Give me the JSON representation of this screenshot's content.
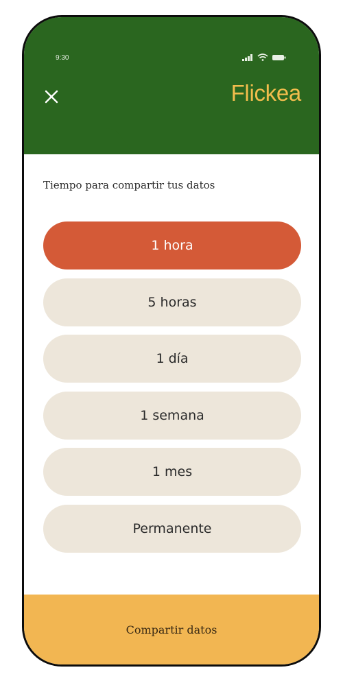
{
  "status_bar": {
    "time": "9:30",
    "icons": [
      "signal-icon",
      "wifi-icon",
      "battery-icon"
    ]
  },
  "header": {
    "close_icon": "close-icon",
    "brand": "Flickea"
  },
  "subtitle": "Tiempo para compartir tus datos",
  "options": [
    {
      "label": "1 hora",
      "selected": true
    },
    {
      "label": "5 horas",
      "selected": false
    },
    {
      "label": "1 día",
      "selected": false
    },
    {
      "label": "1 semana",
      "selected": false
    },
    {
      "label": "1 mes",
      "selected": false
    },
    {
      "label": "Permanente",
      "selected": false
    }
  ],
  "footer": {
    "cta_label": "Compartir datos"
  },
  "colors": {
    "header_bg": "#2a661f",
    "brand": "#f2bd4d",
    "selected": "#d45a37",
    "option_bg": "#ede6da",
    "footer_bg": "#f2b652"
  }
}
